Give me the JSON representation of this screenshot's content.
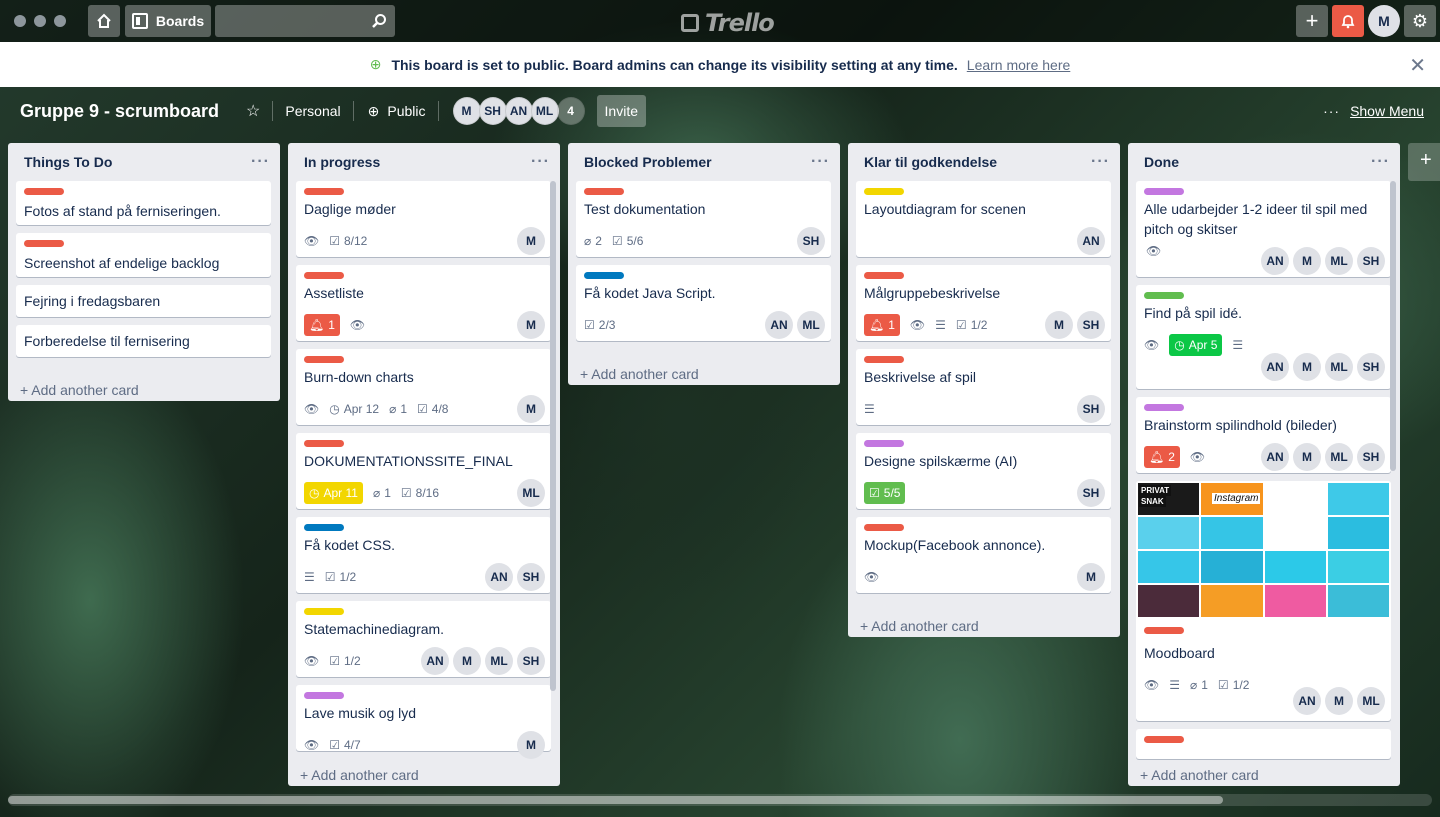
{
  "topbar": {
    "boards_label": "Boards",
    "logo": "Trello",
    "user_initial": "M"
  },
  "banner": {
    "text": "This board is set to public. Board admins can change its visibility setting at any time.",
    "link": "Learn more here"
  },
  "board": {
    "title": "Gruppe 9 - scrumboard",
    "team": "Personal",
    "visibility": "Public",
    "members": [
      "M",
      "SH",
      "AN",
      "ML"
    ],
    "extra_members": "4",
    "invite": "Invite",
    "show_menu": "Show Menu"
  },
  "colors": {
    "red": "#eb5a46",
    "green": "#61bd4f",
    "yellow": "#f2d600",
    "blue": "#0079bf",
    "purple": "#c377e0",
    "brightgreen": "#0bc746"
  },
  "add_card": "Add another card",
  "lists": [
    {
      "title": "Things To Do",
      "cards": [
        {
          "title": "Fotos af stand på ferniseringen."
        },
        {
          "title": "Screenshot af endelige backlog"
        },
        {
          "title": "Fejring i fredagsbaren"
        },
        {
          "title": "Forberedelse til fernisering"
        }
      ]
    },
    {
      "title": "In progress",
      "cards": [
        {
          "title": "Daglige møder",
          "checklist": "8/12",
          "members": [
            "M"
          ]
        },
        {
          "title": "Assetliste",
          "notif": "1",
          "members": [
            "M"
          ]
        },
        {
          "title": "Burn-down charts",
          "date": "Apr 12",
          "attach": "1",
          "checklist": "4/8",
          "members": [
            "M"
          ]
        },
        {
          "title": "DOKUMENTATIONSSITE_FINAL",
          "date": "Apr 11",
          "attach": "1",
          "checklist": "8/16",
          "members": [
            "ML"
          ]
        },
        {
          "title": "Få kodet CSS.",
          "checklist": "1/2",
          "members": [
            "AN",
            "SH"
          ]
        },
        {
          "title": "Statemachinediagram.",
          "checklist": "1/2",
          "members": [
            "AN",
            "M",
            "ML",
            "SH"
          ]
        },
        {
          "title": "Lave musik og lyd",
          "checklist": "4/7",
          "members": [
            "M"
          ]
        }
      ]
    },
    {
      "title": "Blocked Problemer",
      "cards": [
        {
          "title": "Test dokumentation",
          "attach": "2",
          "checklist": "5/6",
          "members": [
            "SH"
          ]
        },
        {
          "title": "Få kodet Java Script.",
          "checklist": "2/3",
          "members": [
            "AN",
            "ML"
          ]
        }
      ]
    },
    {
      "title": "Klar til godkendelse",
      "cards": [
        {
          "title": "Layoutdiagram for scenen",
          "members": [
            "AN"
          ]
        },
        {
          "title": "Målgruppebeskrivelse",
          "notif": "1",
          "checklist": "1/2",
          "members": [
            "M",
            "SH"
          ]
        },
        {
          "title": "Beskrivelse af spil",
          "members": [
            "SH"
          ]
        },
        {
          "title": "Designe spilskærme (AI)",
          "checklist": "5/5",
          "members": [
            "SH"
          ]
        },
        {
          "title": "Mockup(Facebook annonce).",
          "members": [
            "M"
          ]
        }
      ]
    },
    {
      "title": "Done",
      "cards": [
        {
          "title": "Alle udarbejder 1-2 ideer til spil med pitch og skitser",
          "members": [
            "AN",
            "M",
            "ML",
            "SH"
          ]
        },
        {
          "title": "Find på spil idé.",
          "date": "Apr 5",
          "members": [
            "AN",
            "M",
            "ML",
            "SH"
          ]
        },
        {
          "title": "Brainstorm spilindhold (bileder)",
          "notif": "2",
          "members": [
            "AN",
            "M",
            "ML",
            "SH"
          ]
        },
        {
          "title": "Moodboard",
          "attach": "1",
          "checklist": "1/2",
          "members": [
            "AN",
            "M",
            "ML"
          ],
          "cover": {
            "brand1": "PRIVAT",
            "brand2": "SNAK",
            "logo": "Instagram"
          }
        }
      ]
    }
  ]
}
